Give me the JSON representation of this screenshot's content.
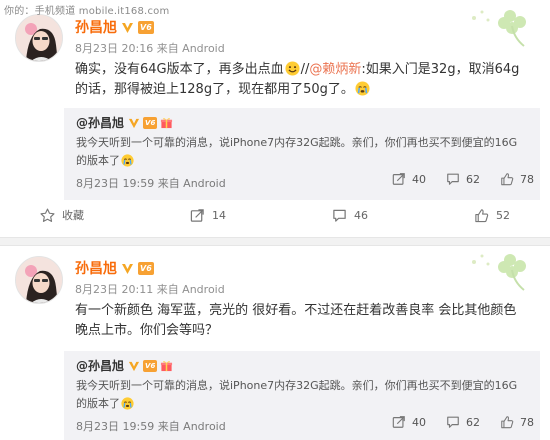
{
  "watermark": "你的：手机频道 mobile.it168.com",
  "posts": [
    {
      "author": "孙昌旭",
      "level": "6",
      "meta": "8月23日 20:16 来自 Android",
      "text_before": "确实，没有64G版本了，再多出点血",
      "text_slash": "//",
      "mention": "@赖炳新",
      "text_after": ":如果入门是32g，取消64g的话，那得被迫上128g了，现在都用了50g了。",
      "quote": {
        "author": "@孙昌旭",
        "text": "我今天听到一个可靠的消息，说iPhone7内存32G起跳。亲们，你们再也买不到便宜的16G的版本了",
        "time": "8月23日 19:59 来自 Android",
        "repost_count": "40",
        "comment_count": "62",
        "like_count": "78"
      },
      "actions": {
        "favorite_label": "收藏",
        "repost_count": "14",
        "comment_count": "46",
        "like_count": "52"
      }
    },
    {
      "author": "孙昌旭",
      "level": "6",
      "meta": "8月23日 20:11 来自 Android",
      "text": "有一个新颜色 海军蓝，亮光的 很好看。不过还在赶着改善良率 会比其他颜色晚点上市。你们会等吗？",
      "quote": {
        "author": "@孙昌旭",
        "text": "我今天听到一个可靠的消息，说iPhone7内存32G起跳。亲们，你们再也买不到便宜的16G的版本了",
        "time": "8月23日 19:59 来自 Android",
        "repost_count": "40",
        "comment_count": "62",
        "like_count": "78"
      }
    }
  ],
  "colors": {
    "author": "#f86c0b",
    "mention": "#eb7350",
    "quote_bg": "#f2f2f5",
    "separator": "#f2f2f2"
  },
  "icons": [
    "verified-v-icon",
    "level-badge-icon",
    "gift-icon",
    "avatar",
    "smile-emoji-icon",
    "crying-emoji-icon",
    "favorite-icon",
    "repost-icon",
    "comment-icon",
    "like-icon",
    "clover-decoration"
  ]
}
